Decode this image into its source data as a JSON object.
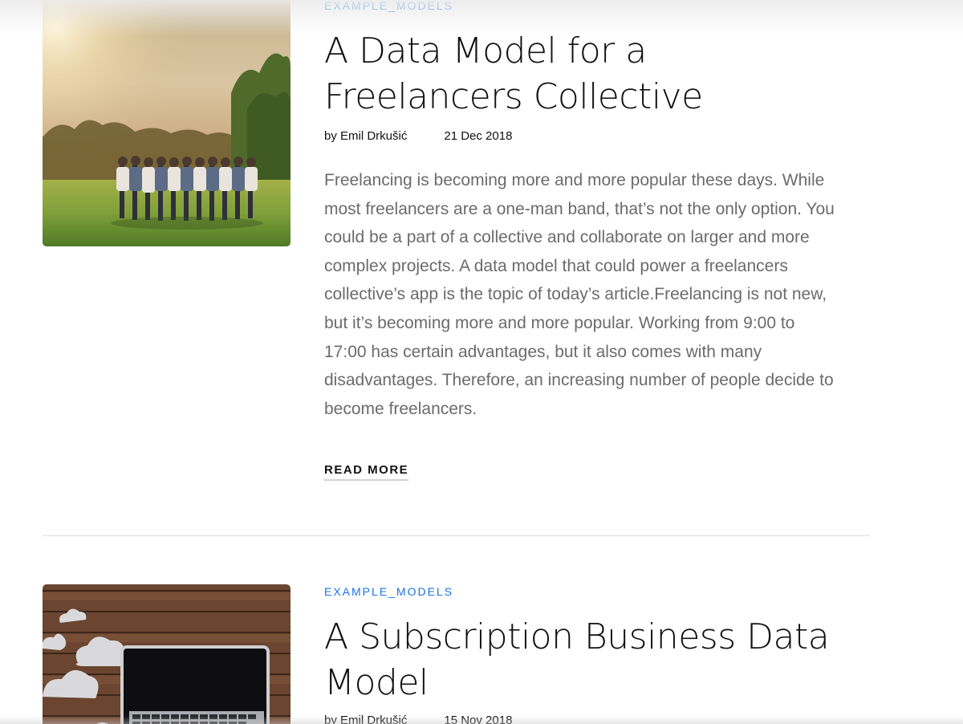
{
  "posts": [
    {
      "category": "EXAMPLE_MODELS",
      "title": "A Data Model for a Freelancers Collective",
      "author": "by Emil Drkušić",
      "date": "21 Dec 2018",
      "excerpt": "Freelancing is becoming more and more popular these days. While most freelancers are a one-man band, that’s not the only option. You could be a part of a collective and collaborate on larger and more complex projects. A data model that could power a freelancers collective’s app is the topic of today’s article.Freelancing is not new, but it’s becoming more and more popular. Working from 9:00 to 17:00 has certain advantages, but it also comes with many disadvantages. Therefore, an increasing number of people decide to become freelancers.",
      "read_more": "READ MORE"
    },
    {
      "category": "EXAMPLE_MODELS",
      "title": "A Subscription Business Data Model",
      "author": "by Emil Drkušić",
      "date": "15 Nov 2018"
    }
  ],
  "colors": {
    "category_link": "#1a73e8",
    "title_text": "#111111",
    "excerpt_text": "#6b6b6b",
    "divider": "#dddddd"
  }
}
